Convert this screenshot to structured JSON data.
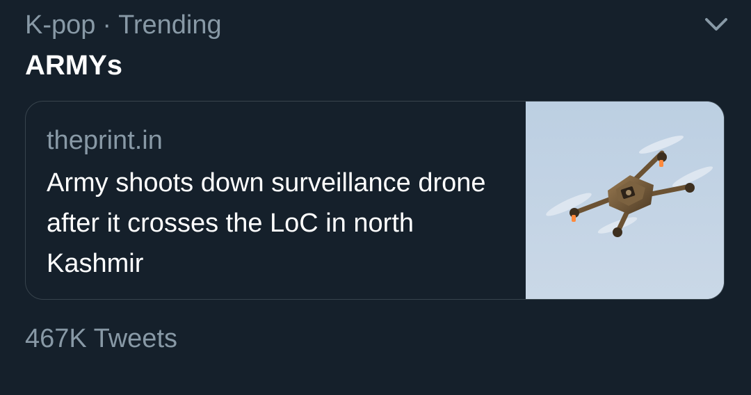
{
  "trend": {
    "category": "K-pop",
    "separator": "·",
    "context_label": "Trending",
    "title": "ARMYs",
    "tweet_count": "467K Tweets",
    "menu_icon": "chevron-down-icon"
  },
  "card": {
    "domain": "theprint.in",
    "headline": "Army shoots down surveillance drone after it crosses the LoC in north Kashmir"
  },
  "colors": {
    "background": "#15202b",
    "secondary_text": "#8899a6",
    "primary_text": "#ffffff",
    "card_border": "#38444d"
  }
}
